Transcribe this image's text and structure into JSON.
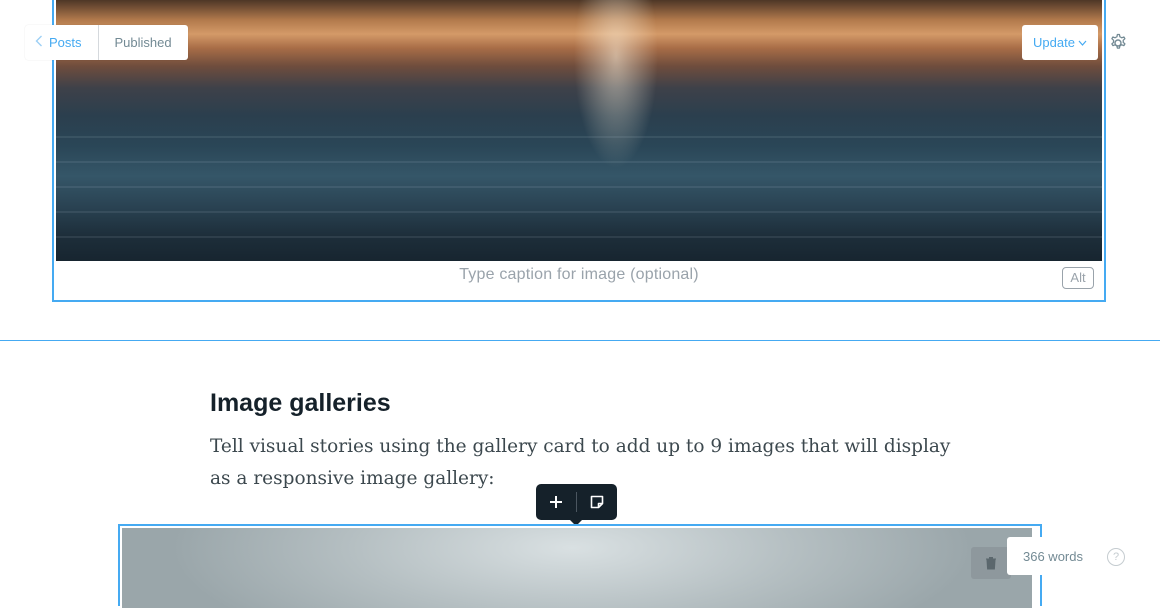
{
  "header": {
    "back_label": "Posts",
    "status": "Published",
    "update_label": "Update"
  },
  "image_card": {
    "caption_placeholder": "Type caption for image (optional)",
    "alt_label": "Alt"
  },
  "content": {
    "heading": "Image galleries",
    "paragraph": "Tell visual stories using the gallery card to add up to 9 images that will display as a responsive image gallery:"
  },
  "footer": {
    "word_count": "366 words",
    "help_label": "?"
  },
  "icons": {
    "back": "chevron-left-icon",
    "update_caret": "chevron-down-icon",
    "settings": "gear-icon",
    "add": "plus-icon",
    "snippet": "snippet-icon",
    "delete": "trash-icon",
    "help": "question-icon"
  },
  "colors": {
    "accent": "#45aaf2",
    "text": "#15212a",
    "muted": "#738a94",
    "toolbar": "#15212a"
  }
}
